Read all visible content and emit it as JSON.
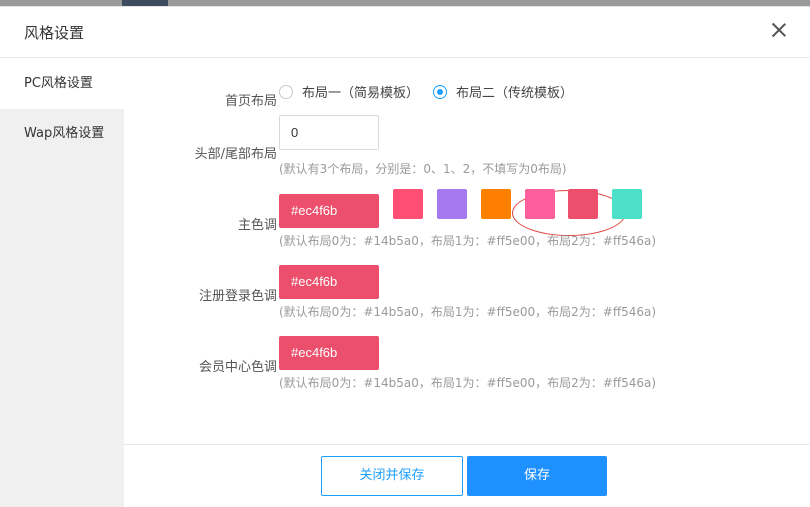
{
  "dialog": {
    "title": "风格设置"
  },
  "sidebar": {
    "items": [
      {
        "label": "PC风格设置"
      },
      {
        "label": "Wap风格设置"
      }
    ]
  },
  "layout": {
    "label": "首页布局",
    "options": [
      {
        "label": "布局一（简易模板）",
        "checked": false
      },
      {
        "label": "布局二（传统模板）",
        "checked": true
      }
    ]
  },
  "header_footer": {
    "label": "头部/尾部布局",
    "value": "0",
    "hint": "(默认有3个布局，分别是：0、1、2，不填写为0布局)"
  },
  "main_color": {
    "label": "主色调",
    "value": "#ec4f6b",
    "hint": "(默认布局0为：#14b5a0，布局1为：#ff5e00，布局2为：#ff546a)",
    "swatches": [
      "#ff5073",
      "#a678f0",
      "#ff8000",
      "#ff5e9e",
      "#ec4f6b",
      "#4de0c8"
    ]
  },
  "register_color": {
    "label": "注册登录色调",
    "value": "#ec4f6b",
    "hint": "(默认布局0为：#14b5a0，布局1为：#ff5e00，布局2为：#ff546a)"
  },
  "member_color": {
    "label": "会员中心色调",
    "value": "#ec4f6b",
    "hint": "(默认布局0为：#14b5a0，布局1为：#ff5e00，布局2为：#ff546a)"
  },
  "footer": {
    "close_save_label": "关闭并保存",
    "save_label": "保存"
  },
  "colors": {
    "accent": "#1e90ff",
    "color_value_bg": "#ec4f6b"
  }
}
